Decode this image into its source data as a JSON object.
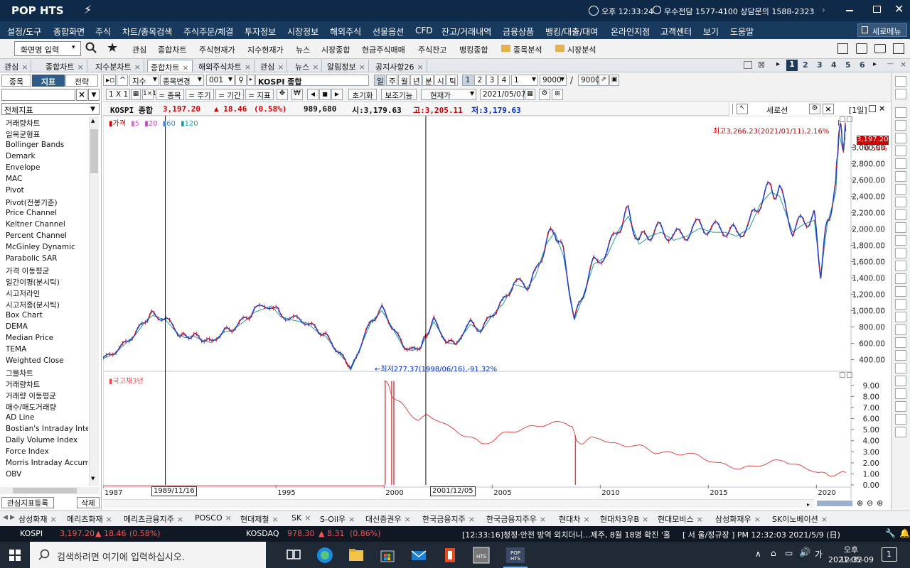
{
  "app": {
    "logo": "POP HTS",
    "time": "오후 12:33:24",
    "branch": "우수전담 1577-4100 상담문의 1588-2323"
  },
  "menu": [
    "설정/도구",
    "종합화면",
    "주식",
    "차트/종목검색",
    "주식주문/체결",
    "투자정보",
    "시장정보",
    "해외주식",
    "선물옵션",
    "CFD",
    "잔고/거래내역",
    "금융상품",
    "뱅킹/대출/대여",
    "온라인지점",
    "고객센터",
    "보기",
    "도움말"
  ],
  "menu_right": "세로메뉴",
  "toolbar": {
    "screen_input": "화면명 입력",
    "links": [
      "관심",
      "종합차트",
      "주식현재가",
      "지수현재가",
      "뉴스",
      "시장종합",
      "현금주식매매",
      "주식잔고",
      "뱅킹종합"
    ],
    "folders": [
      "종목분석",
      "시장분석"
    ]
  },
  "tabs": [
    "관심",
    "종합차트",
    "지수분차트",
    "종합차트",
    "해외주식차트",
    "관심",
    "뉴스",
    "알림정보",
    "공지사항26"
  ],
  "active_tab_index": 3,
  "tab_pages": [
    "1",
    "2",
    "3",
    "4",
    "5",
    "6"
  ],
  "left_panel": {
    "tabs": [
      "종목",
      "지표",
      "전략"
    ],
    "category": "전체지표",
    "indicators": [
      "거래량차트",
      "일목균형표",
      "Bollinger Bands",
      "Demark",
      "Envelope",
      "MAC",
      "Pivot",
      "Pivot(전봉기준)",
      "Price Channel",
      "Keltner Channel",
      "Percent Channel",
      "McGinley Dynamic",
      "Parabolic SAR",
      "가격 이동평균",
      "일간이평(분시틱)",
      "시고저라인",
      "시고저종(분시틱)",
      "Box Chart",
      "DEMA",
      "Median Price",
      "TEMA",
      "Weighted Close",
      "그물차트",
      "거래량차트",
      "거래량 이동평균",
      "매수/매도거래량",
      "AD Line",
      "Bostian's Intraday Intens",
      "Daily Volume Index",
      "Force Index",
      "Morris Intraday Accumu",
      "OBV"
    ],
    "register_btn": "관심지표등록",
    "delete_btn": "삭제"
  },
  "controls": {
    "market": "지수",
    "change_label": "종목변경",
    "code": "001",
    "name": "KOSPI 종합",
    "periods": [
      "일",
      "주",
      "월",
      "년",
      "분",
      "시",
      "틱"
    ],
    "nums": [
      "1",
      "2",
      "3",
      "4"
    ],
    "num_sel": "1",
    "count1": "9000",
    "count2": "9000",
    "ratio": "1 X 1",
    "eq_buttons": [
      "= 종목",
      "= 주기",
      "= 기간",
      "= 지표"
    ],
    "reset": "초기화",
    "aux": "보조기능",
    "price_type": "현재가",
    "date": "2021/05/07"
  },
  "info": {
    "name": "KOSPI 종합",
    "price": "3,197.20",
    "change": "▲ 18.46",
    "pct": "(0.58%)",
    "volume": "989,680",
    "open": "시:3,179.63",
    "high": "고:3,205.11",
    "low": "저:3,179.63"
  },
  "side_tool": {
    "label": "세로선",
    "period": "[1일]"
  },
  "chart_data": [
    {
      "type": "line",
      "legend": [
        "가격",
        "5",
        "20",
        "60",
        "120"
      ],
      "x_ticks": [
        "1987",
        "1995",
        "2000",
        "2005",
        "2010",
        "2015",
        "2020"
      ],
      "y_ticks": [
        "3,000.00",
        "2,800.00",
        "2,600.00",
        "2,400.00",
        "2,200.00",
        "2,000.00",
        "1,800.00",
        "1,600.00",
        "1,400.00",
        "1,200.00",
        "1,000.00",
        "800.00",
        "600.00",
        "400.00"
      ],
      "ylim": [
        300,
        3300
      ],
      "x": [
        1987.0,
        1987.5,
        1988.0,
        1988.5,
        1989.0,
        1989.3,
        1989.9,
        1990.5,
        1990.8,
        1991.2,
        1991.6,
        1992.0,
        1992.6,
        1993.0,
        1993.6,
        1994.0,
        1994.8,
        1995.2,
        1995.8,
        1996.4,
        1996.9,
        1997.3,
        1997.8,
        1998.2,
        1998.46,
        1998.9,
        1999.4,
        1999.9,
        2000.4,
        2000.9,
        2001.3,
        2001.7,
        2001.95,
        2002.3,
        2002.9,
        2003.3,
        2004.0,
        2004.5,
        2005.0,
        2005.5,
        2006.0,
        2006.6,
        2007.0,
        2007.5,
        2007.9,
        2008.3,
        2008.8,
        2009.2,
        2009.7,
        2010.3,
        2010.9,
        2011.3,
        2011.8,
        2012.3,
        2012.8,
        2013.4,
        2014.0,
        2014.6,
        2015.2,
        2015.8,
        2016.3,
        2016.9,
        2017.4,
        2017.9,
        2018.3,
        2018.9,
        2019.4,
        2019.9,
        2020.2,
        2020.5,
        2020.9,
        2021.03,
        2021.2,
        2021.35
      ],
      "values": [
        420,
        480,
        600,
        720,
        900,
        960,
        900,
        720,
        680,
        700,
        650,
        620,
        750,
        780,
        900,
        1000,
        1080,
        950,
        900,
        870,
        760,
        700,
        520,
        400,
        280,
        560,
        880,
        1020,
        800,
        560,
        520,
        560,
        700,
        880,
        620,
        600,
        850,
        760,
        960,
        1100,
        1350,
        1300,
        1450,
        1850,
        2000,
        1700,
        900,
        1200,
        1600,
        1700,
        2050,
        2200,
        1850,
        1950,
        2000,
        1900,
        1950,
        2050,
        2000,
        2000,
        1950,
        2050,
        2350,
        2500,
        2450,
        2000,
        2100,
        2150,
        1450,
        2100,
        2500,
        3266,
        3050,
        3197
      ],
      "labels": {
        "current": "3,197.20",
        "current_pct": "0.58%",
        "high": "최고3,266.23(2021/01/11),2.16%",
        "low": "←최저277.37(1998/06/16),-91.32%"
      },
      "cursor_labels": [
        "1989/11/16",
        "2001/12/05"
      ]
    },
    {
      "type": "line",
      "legend": [
        "국고채3년"
      ],
      "y_ticks": [
        "9.00",
        "8.00",
        "7.00",
        "6.00",
        "5.00",
        "4.00",
        "3.00",
        "2.00",
        "1.00",
        "0.00"
      ],
      "ylim": [
        0,
        9.5
      ],
      "x": [
        2000.0,
        2000.2,
        2000.4,
        2000.8,
        2001.2,
        2001.6,
        2002.0,
        2002.5,
        2003.0,
        2003.5,
        2004.0,
        2004.5,
        2005.0,
        2005.5,
        2006.0,
        2006.5,
        2007.0,
        2007.5,
        2008.0,
        2008.4,
        2008.7,
        2008.9,
        2009.2,
        2009.6,
        2010.0,
        2010.5,
        2011.0,
        2011.5,
        2012.0,
        2012.5,
        2013.0,
        2013.5,
        2014.0,
        2014.5,
        2015.0,
        2015.5,
        2016.0,
        2016.5,
        2017.0,
        2017.5,
        2018.0,
        2018.5,
        2019.0,
        2019.5,
        2020.0,
        2020.3,
        2020.6,
        2021.0,
        2021.35
      ],
      "values": [
        9.4,
        9.0,
        8.0,
        7.3,
        6.5,
        5.8,
        6.3,
        5.9,
        5.2,
        4.7,
        4.3,
        3.7,
        4.0,
        4.6,
        4.9,
        5.1,
        5.3,
        5.5,
        5.6,
        5.7,
        5.2,
        4.0,
        3.8,
        4.2,
        4.3,
        3.7,
        3.6,
        3.6,
        3.4,
        3.0,
        2.9,
        2.8,
        2.9,
        2.6,
        2.3,
        1.9,
        1.7,
        1.5,
        1.6,
        1.9,
        2.1,
        2.2,
        1.9,
        1.4,
        1.3,
        1.0,
        0.9,
        1.0,
        1.1
      ]
    }
  ],
  "stocks": [
    "삼성화재",
    "메리츠화재",
    "메리츠금융지주",
    "POSCO",
    "현대제철",
    "SK",
    "S-Oil우",
    "대신증권우",
    "한국금융지주",
    "한국금융지주우",
    "현대차",
    "현대차3우B",
    "현대모비스",
    "삼성화재우",
    "SK이노베이션"
  ],
  "ticker": {
    "kospi_label": "KOSPI",
    "kospi_val": "3,197.20",
    "kospi_chg": "▲ 18.46",
    "kospi_pct": "(0.58%)",
    "kosdaq_label": "KOSDAQ",
    "kosdaq_val": "978.30",
    "kosdaq_chg": "▲ 8.31",
    "kosdaq_pct": "(0.86%)",
    "news": "[12:33:16]청정·안전 방역 외치더니…제주, 8월 18명 확진 '홀",
    "status": "[ 서  울/정규장 ] PM 12:32:03  2021/5/9 (日)"
  },
  "taskbar": {
    "search": "검색하려면 여기에 입력하십시오.",
    "time": "오후 12:32",
    "date": "2021-05-09",
    "lang": "가",
    "notif": "1"
  }
}
